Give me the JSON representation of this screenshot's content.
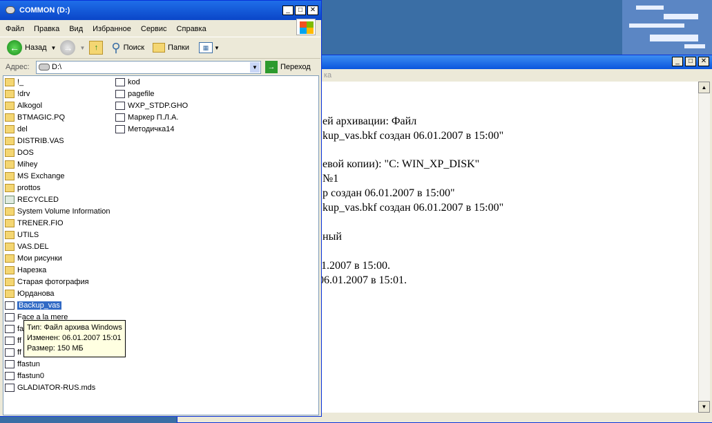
{
  "explorer": {
    "title": "COMMON (D:)",
    "menu": [
      "Файл",
      "Правка",
      "Вид",
      "Избранное",
      "Сервис",
      "Справка"
    ],
    "toolbar": {
      "back": "Назад",
      "search": "Поиск",
      "folders": "Папки"
    },
    "address": {
      "label": "Адрес:",
      "value": "D:\\",
      "go": "Переход"
    },
    "items_col1": [
      {
        "name": "!_",
        "icon": "folder-icon"
      },
      {
        "name": "!drv",
        "icon": "folder-icon"
      },
      {
        "name": "Alkogol",
        "icon": "folder-icon"
      },
      {
        "name": "BTMAGIC.PQ",
        "icon": "folder-icon"
      },
      {
        "name": "del",
        "icon": "folder-icon"
      },
      {
        "name": "DISTRIB.VAS",
        "icon": "folder-icon"
      },
      {
        "name": "DOS",
        "icon": "folder-icon"
      },
      {
        "name": "Mihey",
        "icon": "folder-icon"
      },
      {
        "name": "MS Exchange",
        "icon": "folder-icon"
      },
      {
        "name": "prottos",
        "icon": "folder-icon"
      },
      {
        "name": "RECYCLED",
        "icon": "recycle-icon"
      },
      {
        "name": "System Volume Information",
        "icon": "folder-icon"
      },
      {
        "name": "TRENER.FIO",
        "icon": "folder-icon"
      },
      {
        "name": "UTILS",
        "icon": "folder-icon"
      },
      {
        "name": "VAS.DEL",
        "icon": "folder-icon"
      },
      {
        "name": "Мои рисунки",
        "icon": "folder-icon"
      },
      {
        "name": "Нарезка",
        "icon": "folder-icon"
      },
      {
        "name": "Старая фотография",
        "icon": "folder-icon"
      },
      {
        "name": "Юрданова",
        "icon": "folder-icon"
      },
      {
        "name": "Backup_vas",
        "icon": "backup-file-icon",
        "selected": true
      },
      {
        "name": "Face a la mere",
        "icon": "file-icon"
      },
      {
        "name": "fa",
        "icon": "file-icon"
      },
      {
        "name": "ff",
        "icon": "file-icon"
      },
      {
        "name": "ff",
        "icon": "file-icon"
      },
      {
        "name": "ffastun",
        "icon": "file-icon"
      },
      {
        "name": "ffastun0",
        "icon": "file-icon"
      },
      {
        "name": "GLADIATOR-RUS.mds",
        "icon": "file-icon"
      }
    ],
    "items_col2": [
      {
        "name": "kod",
        "icon": "file-icon"
      },
      {
        "name": "pagefile",
        "icon": "file-icon"
      },
      {
        "name": "WXP_STDP.GHO",
        "icon": "file-icon"
      },
      {
        "name": "Маркер П.Л.А.",
        "icon": "doc-file-icon"
      },
      {
        "name": "Методичка14",
        "icon": "doc-file-icon"
      }
    ],
    "tooltip": {
      "type": "Тип: Файл архива Windows",
      "modified": "Изменен: 06.01.2007 15:01",
      "size": "Размер: 150 МБ"
    }
  },
  "background_doc": {
    "menu_fragment": "ка",
    "lines": [
      "ей архивации: Файл",
      "kup_vas.bkf создан 06.01.2007 в 15:00\"",
      "евой копии): \"C: WIN_XP_DISK\"",
      "№1",
      "р создан 06.01.2007 в 15:00\"",
      "kup_vas.bkf создан 06.01.2007 в 15:00\"",
      "ный",
      ".1.2007 в 15:00.",
      "06.01.2007 в 15:01."
    ]
  },
  "colors": {
    "titlebar": "#0a46c8",
    "selection": "#316ac5",
    "tooltip_bg": "#ffffe1",
    "desktop": "#3a6ea5"
  }
}
